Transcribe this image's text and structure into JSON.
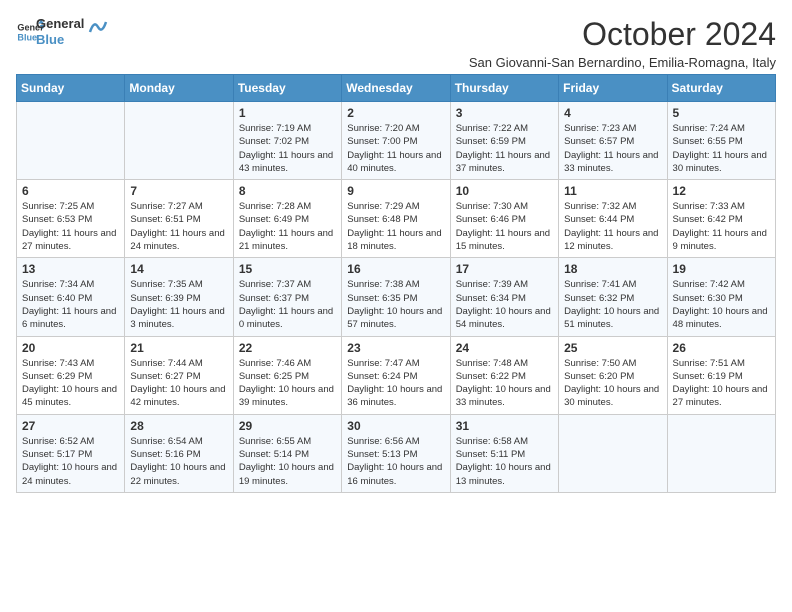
{
  "header": {
    "logo_line1": "General",
    "logo_line2": "Blue",
    "month_title": "October 2024",
    "subtitle": "San Giovanni-San Bernardino, Emilia-Romagna, Italy"
  },
  "weekdays": [
    "Sunday",
    "Monday",
    "Tuesday",
    "Wednesday",
    "Thursday",
    "Friday",
    "Saturday"
  ],
  "weeks": [
    [
      {
        "day": "",
        "sunrise": "",
        "sunset": "",
        "daylight": ""
      },
      {
        "day": "",
        "sunrise": "",
        "sunset": "",
        "daylight": ""
      },
      {
        "day": "1",
        "sunrise": "Sunrise: 7:19 AM",
        "sunset": "Sunset: 7:02 PM",
        "daylight": "Daylight: 11 hours and 43 minutes."
      },
      {
        "day": "2",
        "sunrise": "Sunrise: 7:20 AM",
        "sunset": "Sunset: 7:00 PM",
        "daylight": "Daylight: 11 hours and 40 minutes."
      },
      {
        "day": "3",
        "sunrise": "Sunrise: 7:22 AM",
        "sunset": "Sunset: 6:59 PM",
        "daylight": "Daylight: 11 hours and 37 minutes."
      },
      {
        "day": "4",
        "sunrise": "Sunrise: 7:23 AM",
        "sunset": "Sunset: 6:57 PM",
        "daylight": "Daylight: 11 hours and 33 minutes."
      },
      {
        "day": "5",
        "sunrise": "Sunrise: 7:24 AM",
        "sunset": "Sunset: 6:55 PM",
        "daylight": "Daylight: 11 hours and 30 minutes."
      }
    ],
    [
      {
        "day": "6",
        "sunrise": "Sunrise: 7:25 AM",
        "sunset": "Sunset: 6:53 PM",
        "daylight": "Daylight: 11 hours and 27 minutes."
      },
      {
        "day": "7",
        "sunrise": "Sunrise: 7:27 AM",
        "sunset": "Sunset: 6:51 PM",
        "daylight": "Daylight: 11 hours and 24 minutes."
      },
      {
        "day": "8",
        "sunrise": "Sunrise: 7:28 AM",
        "sunset": "Sunset: 6:49 PM",
        "daylight": "Daylight: 11 hours and 21 minutes."
      },
      {
        "day": "9",
        "sunrise": "Sunrise: 7:29 AM",
        "sunset": "Sunset: 6:48 PM",
        "daylight": "Daylight: 11 hours and 18 minutes."
      },
      {
        "day": "10",
        "sunrise": "Sunrise: 7:30 AM",
        "sunset": "Sunset: 6:46 PM",
        "daylight": "Daylight: 11 hours and 15 minutes."
      },
      {
        "day": "11",
        "sunrise": "Sunrise: 7:32 AM",
        "sunset": "Sunset: 6:44 PM",
        "daylight": "Daylight: 11 hours and 12 minutes."
      },
      {
        "day": "12",
        "sunrise": "Sunrise: 7:33 AM",
        "sunset": "Sunset: 6:42 PM",
        "daylight": "Daylight: 11 hours and 9 minutes."
      }
    ],
    [
      {
        "day": "13",
        "sunrise": "Sunrise: 7:34 AM",
        "sunset": "Sunset: 6:40 PM",
        "daylight": "Daylight: 11 hours and 6 minutes."
      },
      {
        "day": "14",
        "sunrise": "Sunrise: 7:35 AM",
        "sunset": "Sunset: 6:39 PM",
        "daylight": "Daylight: 11 hours and 3 minutes."
      },
      {
        "day": "15",
        "sunrise": "Sunrise: 7:37 AM",
        "sunset": "Sunset: 6:37 PM",
        "daylight": "Daylight: 11 hours and 0 minutes."
      },
      {
        "day": "16",
        "sunrise": "Sunrise: 7:38 AM",
        "sunset": "Sunset: 6:35 PM",
        "daylight": "Daylight: 10 hours and 57 minutes."
      },
      {
        "day": "17",
        "sunrise": "Sunrise: 7:39 AM",
        "sunset": "Sunset: 6:34 PM",
        "daylight": "Daylight: 10 hours and 54 minutes."
      },
      {
        "day": "18",
        "sunrise": "Sunrise: 7:41 AM",
        "sunset": "Sunset: 6:32 PM",
        "daylight": "Daylight: 10 hours and 51 minutes."
      },
      {
        "day": "19",
        "sunrise": "Sunrise: 7:42 AM",
        "sunset": "Sunset: 6:30 PM",
        "daylight": "Daylight: 10 hours and 48 minutes."
      }
    ],
    [
      {
        "day": "20",
        "sunrise": "Sunrise: 7:43 AM",
        "sunset": "Sunset: 6:29 PM",
        "daylight": "Daylight: 10 hours and 45 minutes."
      },
      {
        "day": "21",
        "sunrise": "Sunrise: 7:44 AM",
        "sunset": "Sunset: 6:27 PM",
        "daylight": "Daylight: 10 hours and 42 minutes."
      },
      {
        "day": "22",
        "sunrise": "Sunrise: 7:46 AM",
        "sunset": "Sunset: 6:25 PM",
        "daylight": "Daylight: 10 hours and 39 minutes."
      },
      {
        "day": "23",
        "sunrise": "Sunrise: 7:47 AM",
        "sunset": "Sunset: 6:24 PM",
        "daylight": "Daylight: 10 hours and 36 minutes."
      },
      {
        "day": "24",
        "sunrise": "Sunrise: 7:48 AM",
        "sunset": "Sunset: 6:22 PM",
        "daylight": "Daylight: 10 hours and 33 minutes."
      },
      {
        "day": "25",
        "sunrise": "Sunrise: 7:50 AM",
        "sunset": "Sunset: 6:20 PM",
        "daylight": "Daylight: 10 hours and 30 minutes."
      },
      {
        "day": "26",
        "sunrise": "Sunrise: 7:51 AM",
        "sunset": "Sunset: 6:19 PM",
        "daylight": "Daylight: 10 hours and 27 minutes."
      }
    ],
    [
      {
        "day": "27",
        "sunrise": "Sunrise: 6:52 AM",
        "sunset": "Sunset: 5:17 PM",
        "daylight": "Daylight: 10 hours and 24 minutes."
      },
      {
        "day": "28",
        "sunrise": "Sunrise: 6:54 AM",
        "sunset": "Sunset: 5:16 PM",
        "daylight": "Daylight: 10 hours and 22 minutes."
      },
      {
        "day": "29",
        "sunrise": "Sunrise: 6:55 AM",
        "sunset": "Sunset: 5:14 PM",
        "daylight": "Daylight: 10 hours and 19 minutes."
      },
      {
        "day": "30",
        "sunrise": "Sunrise: 6:56 AM",
        "sunset": "Sunset: 5:13 PM",
        "daylight": "Daylight: 10 hours and 16 minutes."
      },
      {
        "day": "31",
        "sunrise": "Sunrise: 6:58 AM",
        "sunset": "Sunset: 5:11 PM",
        "daylight": "Daylight: 10 hours and 13 minutes."
      },
      {
        "day": "",
        "sunrise": "",
        "sunset": "",
        "daylight": ""
      },
      {
        "day": "",
        "sunrise": "",
        "sunset": "",
        "daylight": ""
      }
    ]
  ]
}
